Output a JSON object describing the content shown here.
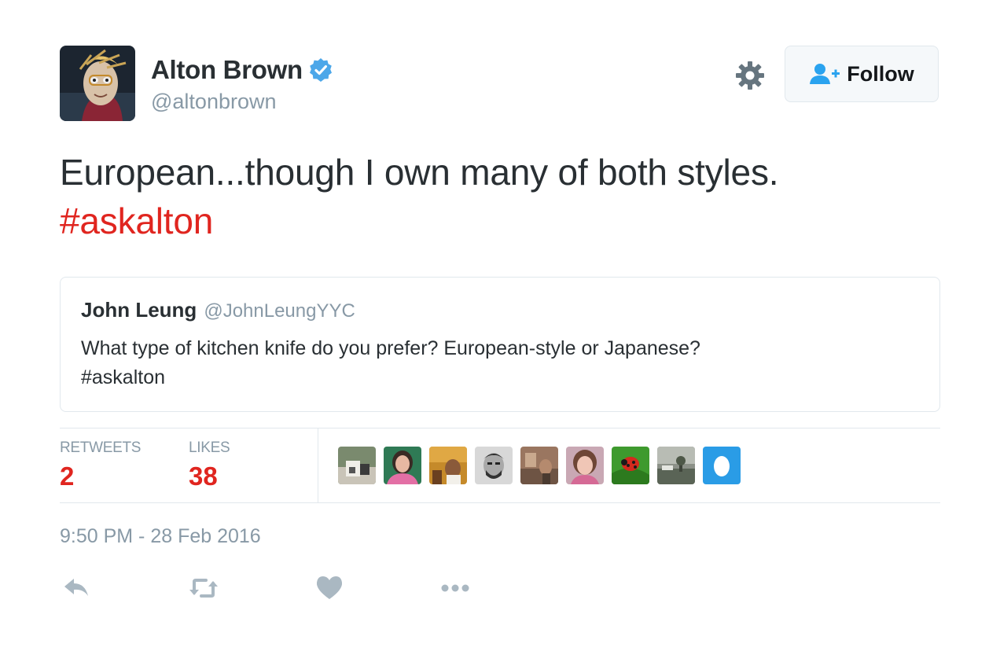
{
  "colors": {
    "accent": "#e0251f",
    "text": "#292f33",
    "secondary": "#8899a6",
    "verified": "#4ca7e9",
    "follow_icon": "#2aa3ef",
    "border": "#e1e8ed"
  },
  "author": {
    "display_name": "Alton Brown",
    "handle": "@altonbrown",
    "verified": true,
    "avatar_icon": "avatar-puppet-photo"
  },
  "header": {
    "settings_icon": "gear-icon",
    "follow_label": "Follow",
    "follow_icon": "add-user-icon"
  },
  "tweet": {
    "text": "European...though I own many of both styles.",
    "hashtag": "#askalton"
  },
  "quoted_tweet": {
    "name": "John Leung",
    "handle": "@JohnLeungYYC",
    "text_line1": "What type of kitchen knife do you prefer? European-style or Japanese?",
    "text_line2": "#askalton"
  },
  "stats": {
    "retweets_label": "RETWEETS",
    "retweets_count": "2",
    "likes_label": "LIKES",
    "likes_count": "38"
  },
  "likers": [
    {
      "icon": "liker-avatar-1"
    },
    {
      "icon": "liker-avatar-2"
    },
    {
      "icon": "liker-avatar-3"
    },
    {
      "icon": "liker-avatar-4"
    },
    {
      "icon": "liker-avatar-5"
    },
    {
      "icon": "liker-avatar-6"
    },
    {
      "icon": "liker-avatar-7-ladybug"
    },
    {
      "icon": "liker-avatar-8"
    },
    {
      "icon": "liker-avatar-9-default-egg"
    }
  ],
  "timestamp": "9:50 PM - 28 Feb 2016",
  "actions": [
    "reply-icon",
    "retweet-icon",
    "like-icon",
    "more-icon"
  ]
}
